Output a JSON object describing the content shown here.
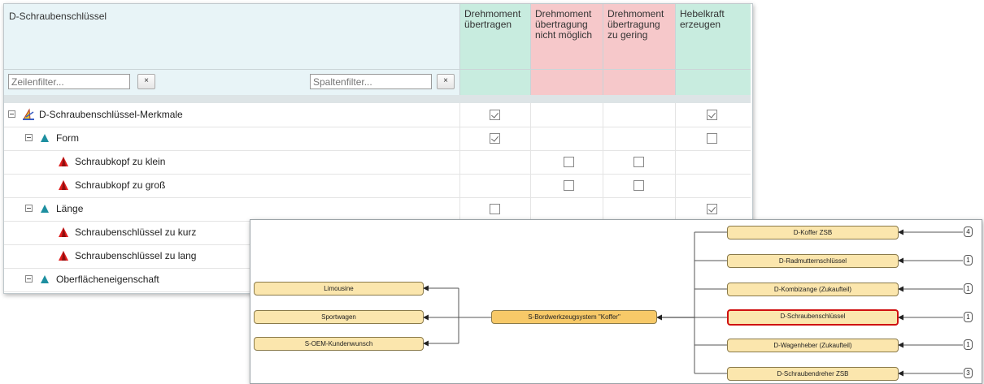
{
  "matrix": {
    "title": "D-Schraubenschlüssel",
    "columns": [
      {
        "line1": "Drehmoment",
        "line2": "übertragen",
        "line3": ""
      },
      {
        "line1": "Drehmoment",
        "line2": "übertragung",
        "line3": "nicht möglich"
      },
      {
        "line1": "Drehmoment",
        "line2": "übertragung",
        "line3": "zu gering"
      },
      {
        "line1": "Hebelkraft",
        "line2": "erzeugen",
        "line3": ""
      }
    ],
    "row_filter_placeholder": "Zeilenfilter...",
    "col_filter_placeholder": "Spaltenfilter...",
    "clear_label": "×",
    "rows": [
      {
        "label": "D-Schraubenschlüssel-Merkmale",
        "cells": [
          "checked",
          "",
          "",
          "checked"
        ]
      },
      {
        "label": "Form",
        "cells": [
          "checked",
          "",
          "",
          "unchecked"
        ]
      },
      {
        "label": "Schraubkopf zu klein",
        "cells": [
          "",
          "unchecked",
          "unchecked",
          ""
        ]
      },
      {
        "label": "Schraubkopf zu groß",
        "cells": [
          "",
          "unchecked",
          "unchecked",
          ""
        ]
      },
      {
        "label": "Länge",
        "cells": [
          "unchecked",
          "",
          "",
          "checked"
        ]
      },
      {
        "label": "Schraubenschlüssel zu kurz",
        "cells": [
          "",
          "",
          "",
          ""
        ]
      },
      {
        "label": "Schraubenschlüssel zu lang",
        "cells": [
          "",
          "",
          "",
          ""
        ]
      },
      {
        "label": "Oberflächeneigenschaft",
        "cells": [
          "",
          "",
          "",
          ""
        ]
      }
    ]
  },
  "tree": {
    "center": "S-Bordwerkzeugsystem \"Koffer\"",
    "left_nodes": [
      "Limousine",
      "Sportwagen",
      "S-OEM-Kundenwunsch"
    ],
    "right_nodes": [
      {
        "label": "D-Koffer ZSB",
        "count": "4"
      },
      {
        "label": "D-Radmutternschlüssel",
        "count": "1"
      },
      {
        "label": "D-Kombizange (Zukaufteil)",
        "count": "1"
      },
      {
        "label": "D-Schraubenschlüssel",
        "count": "1",
        "selected": true
      },
      {
        "label": "D-Wagenheber (Zukaufteil)",
        "count": "1"
      },
      {
        "label": "D-Schraubendreher ZSB",
        "count": "3"
      }
    ]
  },
  "colors": {
    "header_bg": "#e8f4f7",
    "green_col": "#c8ecdf",
    "red_col": "#f6c8ca",
    "node_fill": "#fbe6ad",
    "center_fill": "#f7c968",
    "selection": "#d01010"
  }
}
